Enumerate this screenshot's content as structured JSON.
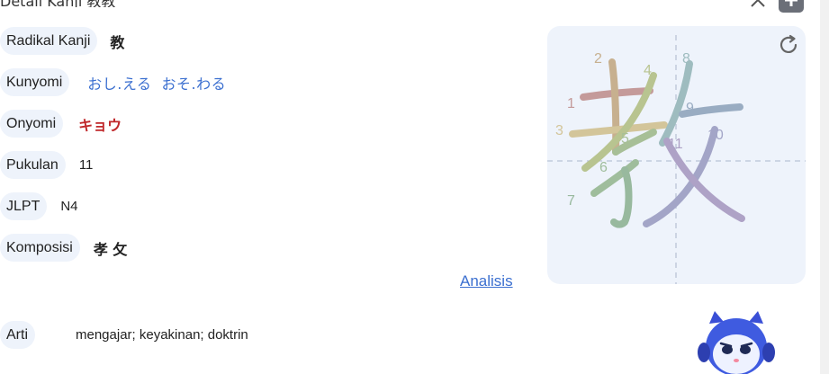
{
  "header": {
    "title": "Detail Kanji 教教"
  },
  "details": [
    {
      "label": "Radikal Kanji",
      "value": "教"
    },
    {
      "label": "Kunyomi",
      "value": "おし.える  おそ.わる"
    },
    {
      "label": "Onyomi",
      "value": "キョウ"
    },
    {
      "label": "Pukulan",
      "value": "11"
    },
    {
      "label": "JLPT",
      "value": "N4"
    },
    {
      "label": "Komposisi",
      "value": "孝 攵"
    }
  ],
  "analysis_link": "Analisis",
  "meaning": {
    "label": "Arti",
    "value": "mengajar; keyakinan; doktrin"
  },
  "stroke_panel": {
    "stroke_numbers": [
      "1",
      "2",
      "3",
      "4",
      "5",
      "6",
      "7",
      "8",
      "9",
      "10",
      "11"
    ]
  }
}
